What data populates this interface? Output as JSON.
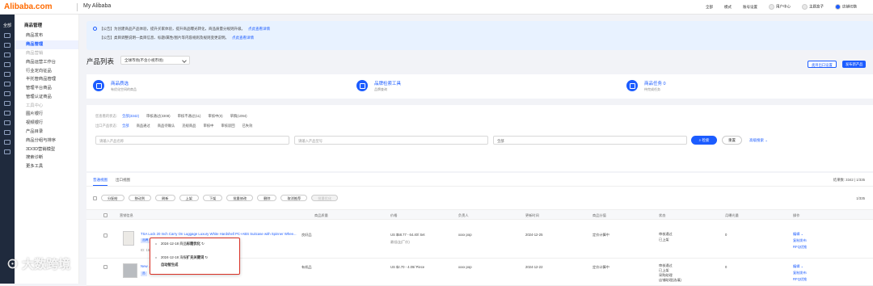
{
  "header": {
    "logo": "Alibaba.com",
    "section": "My Alibaba",
    "links": [
      "全部",
      "模式",
      "账号设置",
      "用户中心",
      "主题盒子",
      "店铺切换"
    ]
  },
  "leftnav": {
    "all": "全部"
  },
  "sidebar": {
    "group1": "商品管理",
    "items": [
      {
        "label": "商品发布",
        "state": ""
      },
      {
        "label": "商品管理",
        "state": "active"
      },
      {
        "label": "商品营销",
        "state": "grey"
      },
      {
        "label": "商品运营工作台",
        "state": ""
      },
      {
        "label": "行业定向征品",
        "state": ""
      },
      {
        "label": "半托管商品管理",
        "state": ""
      },
      {
        "label": "管理平台商品",
        "state": ""
      },
      {
        "label": "管理认证商品",
        "state": ""
      },
      {
        "label": "工具中心",
        "state": "grey"
      },
      {
        "label": "图片银行",
        "state": ""
      },
      {
        "label": "视频银行",
        "state": ""
      },
      {
        "label": "产品目录",
        "state": ""
      },
      {
        "label": "商品分组与排序",
        "state": ""
      },
      {
        "label": "3D/3D营销模型",
        "state": ""
      },
      {
        "label": "搜索诊断",
        "state": ""
      },
      {
        "label": "更多工具",
        "state": ""
      }
    ]
  },
  "notice": {
    "line1": "【公告】为创建商品产品体验，提升买家体验，提升商品曝光转化，商品质量分规则升级。",
    "link1": "点此查看详情",
    "line2": "【公告】类目调整说明—类目信息、标题/属性/图片等内容规则及规则变更说明。",
    "link2": "点此查看详情"
  },
  "page": {
    "title": "产品列表",
    "select_value": "全球市场(不含小视市场)",
    "btn_manage": "类目出口设置",
    "btn_publish": "发布新产品"
  },
  "cards": [
    {
      "title": "商品质选",
      "sub": "有优化空间的商品"
    },
    {
      "title": "品牌检索工具",
      "sub": "品牌查询"
    },
    {
      "title": "商品任务   0",
      "sub": "待完成任务"
    }
  ],
  "filters": {
    "row1": {
      "label": "您查看的状态:",
      "options": [
        {
          "t": "全部(3342)",
          "on": true
        },
        {
          "t": "审核通过(3308)",
          "on": false
        },
        {
          "t": "审核不通过(11)",
          "on": false
        },
        {
          "t": "审核中(0)",
          "on": false
        },
        {
          "t": "草稿(1094)",
          "on": false
        }
      ]
    },
    "row2": {
      "label": "出口产品状态:",
      "options": [
        {
          "t": "全部",
          "on": true
        },
        {
          "t": "商品通过",
          "on": false
        },
        {
          "t": "商品待确认",
          "on": false
        },
        {
          "t": "违规商品",
          "on": false
        },
        {
          "t": "审核中",
          "on": false
        },
        {
          "t": "审核驳回",
          "on": false
        },
        {
          "t": "已失效",
          "on": false
        }
      ]
    },
    "input1": "请输入产品名称",
    "input2": "请输入产品型号",
    "input3": "全部",
    "search": "检索",
    "reset": "重置",
    "advanced": "高级搜索"
  },
  "table": {
    "tabs": [
      "普通视图",
      "出口视图"
    ],
    "summary": "结果数: 3342 | 1/335",
    "page_counter": "1/335",
    "toolbar": [
      "分配给",
      "移动到",
      "刷新",
      "上架",
      "下架",
      "批量修改",
      "删除",
      "取消推荐",
      "批量优化"
    ],
    "headers": [
      "营销信息",
      "商品质量",
      "价格",
      "负责人",
      "更新时间",
      "商品分值",
      "状态",
      "月曝光量",
      "操作"
    ],
    "rows": [
      {
        "title": "TSA Lock 20 Inch Carry On Luggage Luxury White Hardshell PC+ABS Suitcase with Spinner Whee...",
        "tags": [
          "品牌",
          "标"
        ],
        "id": "ID: 1601270913xx",
        "badge": "待优化",
        "quality": "良好品",
        "price": "US $58.77 - 64.40/ Set",
        "price_sub": "最低(出厂价)",
        "owner": "xxxx pop",
        "time": "2024-12-25",
        "score": "定价计算中",
        "status": [
          "审核通过",
          "已上架"
        ],
        "exposure": "0",
        "ops": [
          "编辑",
          "复制发布",
          "RFQ优推"
        ]
      },
      {
        "title": "New ... Tumbler 30 OZ 40 OZ Mug with Straw...",
        "tags": [
          "品"
        ],
        "id": "",
        "badge": "",
        "quality": "有机品",
        "price": "US $2.70 - 4.09/ Piece",
        "price_sub": "",
        "owner": "xxxx pop",
        "time": "2024-12-22",
        "score": "定价计算中",
        "status": [
          "审核通过",
          "已上架",
          "采购助理",
          "店铺助理(选填)"
        ],
        "exposure": "0",
        "ops": [
          "编辑",
          "复制发布",
          "RFQ优推"
        ]
      }
    ]
  },
  "popup": {
    "items": [
      {
        "date": "2024-12-18",
        "text": "商品",
        "bold": "标题优化",
        "icon": "↻"
      },
      {
        "date": "2024-12-18",
        "text": "海报",
        "bold": "扩充关键词",
        "icon": "↻"
      }
    ],
    "footer": "自动智生成"
  },
  "watermark": "大数跨境"
}
